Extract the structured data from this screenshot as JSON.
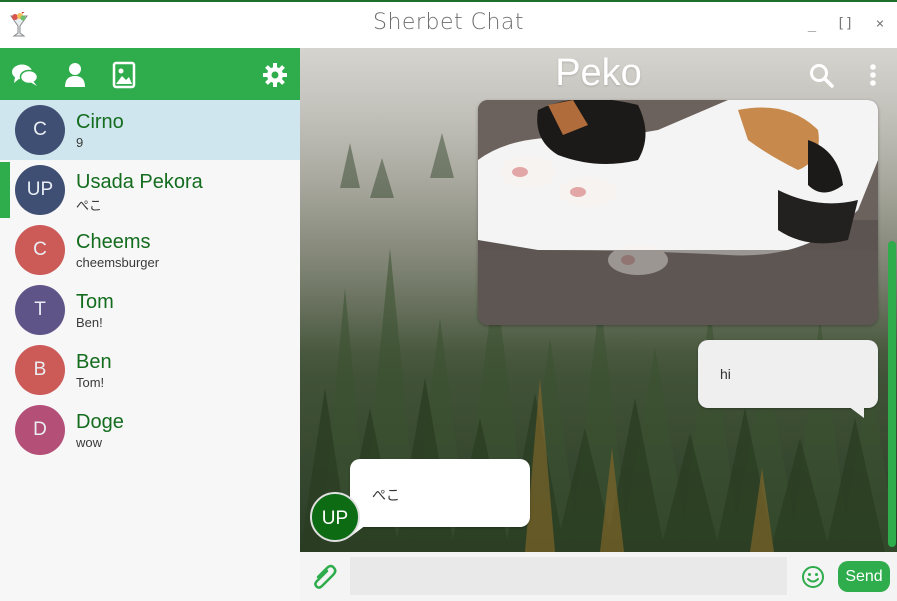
{
  "app": {
    "title": "Sherbet Chat",
    "icon": "sherbet-cup-icon",
    "window_controls": {
      "minimize": "_",
      "maximize": "[]",
      "close": "×"
    }
  },
  "colors": {
    "accent": "#2fac4c",
    "name_text": "#146c1e",
    "selected_row": "#cfe6ee"
  },
  "sidebar": {
    "toolbar": {
      "icons": [
        "chats-icon",
        "contacts-icon",
        "image-icon",
        "settings-gear-icon"
      ]
    },
    "chats": [
      {
        "initials": "C",
        "name": "Cirno",
        "preview": "9",
        "color": "#3f4f73",
        "selected": true
      },
      {
        "initials": "UP",
        "name": "Usada Pekora",
        "preview": "ぺこ",
        "color": "#3f4f73",
        "active": true
      },
      {
        "initials": "C",
        "name": "Cheems",
        "preview": "cheemsburger",
        "color": "#cc5a57"
      },
      {
        "initials": "T",
        "name": "Tom",
        "preview": "Ben!",
        "color": "#5e5488"
      },
      {
        "initials": "B",
        "name": "Ben",
        "preview": "Tom!",
        "color": "#cc5a57"
      },
      {
        "initials": "D",
        "name": "Doge",
        "preview": "wow",
        "color": "#b44f78"
      }
    ]
  },
  "main": {
    "header": {
      "title": "Peko",
      "search_icon": "search-icon",
      "menu_icon": "more-vertical-icon"
    },
    "messages": [
      {
        "type": "image",
        "direction": "outgoing",
        "content": "photo of calico cat sleeping"
      },
      {
        "type": "text",
        "direction": "outgoing",
        "text": "hi"
      },
      {
        "type": "text",
        "direction": "incoming",
        "text": "ぺこ",
        "sender_initials": "UP"
      }
    ]
  },
  "input": {
    "placeholder": "",
    "value": "",
    "attach_icon": "paperclip-icon",
    "emoji_icon": "emoji-icon",
    "send_label": "Send"
  }
}
